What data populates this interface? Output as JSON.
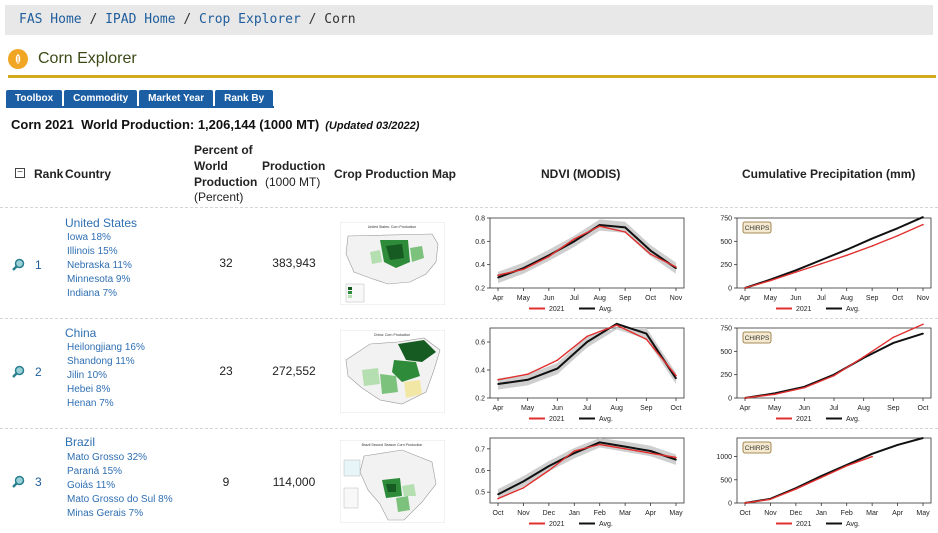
{
  "breadcrumb": {
    "items": [
      "FAS Home",
      "IPAD Home",
      "Crop Explorer",
      "Corn"
    ],
    "separator": "/"
  },
  "page_title": "Corn Explorer",
  "tabs": [
    "Toolbox",
    "Commodity",
    "Market Year",
    "Rank By"
  ],
  "summary": {
    "text": "Corn 2021  World Production: 1,206,144 (1000 MT)",
    "updated": "(Updated 03/2022)"
  },
  "table": {
    "headers": {
      "collapse_symbol": "⊟",
      "rank": "Rank",
      "country": "Country",
      "percent": "Percent of World Production",
      "percent_unit": "(Percent)",
      "production": "Production",
      "production_unit": "(1000 MT)",
      "map": "Crop Production Map",
      "ndvi": "NDVI (MODIS)",
      "precip": "Cumulative Precipitation (mm)"
    },
    "rows": [
      {
        "rank": "1",
        "country": "United States",
        "states": [
          "Iowa 18%",
          "Illinois 15%",
          "Nebraska 11%",
          "Minnesota 9%",
          "Indiana 7%"
        ],
        "percent": "32",
        "production": "383,943",
        "map_title": "United States: Corn Production"
      },
      {
        "rank": "2",
        "country": "China",
        "states": [
          "Heilongjiang 16%",
          "Shandong 11%",
          "Jilin 10%",
          "Hebei 8%",
          "Henan 7%"
        ],
        "percent": "23",
        "production": "272,552",
        "map_title": "China: Corn Production"
      },
      {
        "rank": "3",
        "country": "Brazil",
        "states": [
          "Mato Grosso 32%",
          "Paraná 15%",
          "Goiás 11%",
          "Mato Grosso do Sul 8%",
          "Minas Gerais 7%"
        ],
        "percent": "9",
        "production": "114,000",
        "map_title": "Brazil Second Season Corn Production"
      }
    ]
  },
  "chart_data": [
    {
      "type": "line",
      "id": "us-ndvi",
      "x": [
        "Apr",
        "May",
        "Jun",
        "Jul",
        "Aug",
        "Sep",
        "Oct",
        "Nov"
      ],
      "ylim": [
        0.2,
        0.8
      ],
      "yticks": [
        0.2,
        0.4,
        0.6,
        0.8
      ],
      "series": [
        {
          "name": "2021",
          "values": [
            0.31,
            0.36,
            0.47,
            0.62,
            0.73,
            0.68,
            0.49,
            0.38
          ],
          "color": "#e0302f"
        },
        {
          "name": "Avg.",
          "values": [
            0.29,
            0.37,
            0.48,
            0.6,
            0.74,
            0.72,
            0.52,
            0.37
          ],
          "color": "#111111"
        }
      ]
    },
    {
      "type": "line",
      "id": "us-precip",
      "badge": "CHIRPS",
      "x": [
        "Apr",
        "May",
        "Jun",
        "Jul",
        "Aug",
        "Sep",
        "Oct",
        "Nov"
      ],
      "ylim": [
        0,
        750
      ],
      "yticks": [
        0,
        250,
        500,
        750
      ],
      "series": [
        {
          "name": "2021",
          "values": [
            0,
            80,
            170,
            260,
            350,
            450,
            560,
            680
          ],
          "color": "#e0302f"
        },
        {
          "name": "Avg.",
          "values": [
            0,
            90,
            190,
            300,
            410,
            530,
            640,
            760
          ],
          "color": "#111111"
        }
      ]
    },
    {
      "type": "line",
      "id": "china-ndvi",
      "x": [
        "Apr",
        "May",
        "Jun",
        "Jul",
        "Aug",
        "Sep",
        "Oct"
      ],
      "ylim": [
        0.2,
        0.7
      ],
      "yticks": [
        0.2,
        0.4,
        0.6
      ],
      "series": [
        {
          "name": "2021",
          "values": [
            0.33,
            0.37,
            0.47,
            0.64,
            0.72,
            0.62,
            0.36
          ],
          "color": "#e0302f"
        },
        {
          "name": "Avg.",
          "values": [
            0.3,
            0.33,
            0.41,
            0.6,
            0.73,
            0.66,
            0.34
          ],
          "color": "#111111"
        }
      ]
    },
    {
      "type": "line",
      "id": "china-precip",
      "badge": "CHIRPS",
      "x": [
        "Apr",
        "May",
        "Jun",
        "Jul",
        "Aug",
        "Sep",
        "Oct"
      ],
      "ylim": [
        0,
        750
      ],
      "yticks": [
        0,
        250,
        500,
        750
      ],
      "series": [
        {
          "name": "2021",
          "values": [
            0,
            40,
            110,
            240,
            440,
            650,
            790
          ],
          "color": "#e0302f"
        },
        {
          "name": "Avg.",
          "values": [
            0,
            50,
            120,
            250,
            430,
            590,
            690
          ],
          "color": "#111111"
        }
      ]
    },
    {
      "type": "line",
      "id": "brazil-ndvi",
      "x": [
        "Oct",
        "Nov",
        "Dec",
        "Jan",
        "Feb",
        "Mar",
        "Apr",
        "May"
      ],
      "ylim": [
        0.45,
        0.75
      ],
      "yticks": [
        0.5,
        0.6,
        0.7
      ],
      "series": [
        {
          "name": "2021",
          "values": [
            0.47,
            0.52,
            0.6,
            0.69,
            0.72,
            0.7,
            0.68,
            0.66
          ],
          "color": "#e0302f"
        },
        {
          "name": "Avg.",
          "values": [
            0.49,
            0.55,
            0.62,
            0.68,
            0.73,
            0.71,
            0.69,
            0.65
          ],
          "color": "#111111"
        }
      ]
    },
    {
      "type": "line",
      "id": "brazil-precip",
      "badge": "CHIRPS",
      "x": [
        "Oct",
        "Nov",
        "Dec",
        "Jan",
        "Feb",
        "Mar",
        "Apr",
        "May"
      ],
      "ylim": [
        0,
        1400
      ],
      "yticks": [
        0,
        500,
        1000
      ],
      "series": [
        {
          "name": "2021",
          "values": [
            0,
            80,
            300,
            550,
            800,
            1000,
            null,
            null
          ],
          "color": "#e0302f"
        },
        {
          "name": "Avg.",
          "values": [
            0,
            90,
            320,
            580,
            820,
            1060,
            1250,
            1400
          ],
          "color": "#111111"
        }
      ]
    }
  ]
}
